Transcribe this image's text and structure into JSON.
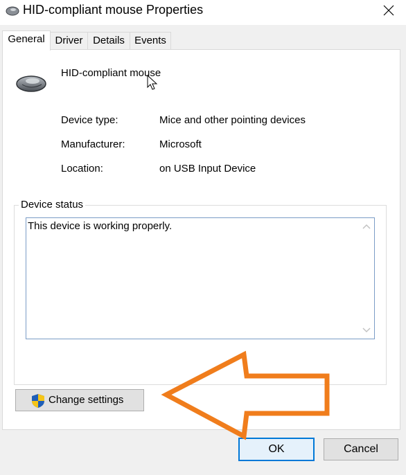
{
  "window": {
    "title": "HID-compliant mouse Properties",
    "title_icon": "mouse-icon",
    "close_icon": "close-icon"
  },
  "tabs": [
    {
      "label": "General",
      "active": true
    },
    {
      "label": "Driver",
      "active": false
    },
    {
      "label": "Details",
      "active": false
    },
    {
      "label": "Events",
      "active": false
    }
  ],
  "device": {
    "name": "HID-compliant mouse",
    "icon": "mouse-icon",
    "properties": [
      {
        "label": "Device type:",
        "value": "Mice and other pointing devices"
      },
      {
        "label": "Manufacturer:",
        "value": "Microsoft"
      },
      {
        "label": "Location:",
        "value": "on USB Input Device"
      }
    ]
  },
  "status": {
    "legend": "Device status",
    "text": "This device is working properly."
  },
  "buttons": {
    "change_settings": "Change settings",
    "ok": "OK",
    "cancel": "Cancel"
  },
  "colors": {
    "annotation_arrow": "#f07d1c",
    "focus_border": "#0078d7"
  }
}
